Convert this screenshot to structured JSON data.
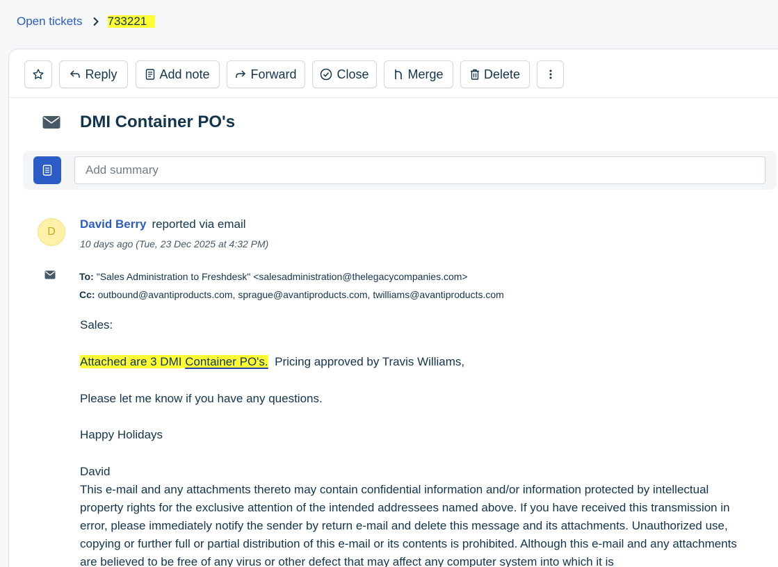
{
  "breadcrumb": {
    "parent": "Open tickets",
    "current": "733221"
  },
  "toolbar": {
    "reply": "Reply",
    "add_note": "Add note",
    "forward": "Forward",
    "close": "Close",
    "merge": "Merge",
    "delete": "Delete"
  },
  "ticket": {
    "subject": "DMI Container PO's",
    "summary_placeholder": "Add summary"
  },
  "message": {
    "avatar_letter": "D",
    "sender": "David Berry",
    "via": "reported via email",
    "timestamp": "10 days ago (Tue, 23 Dec 2025 at 4:32 PM)",
    "to_label": "To:",
    "to": "\"Sales Administration to Freshdesk\" <salesadministration@thelegacycompanies.com>",
    "cc_label": "Cc:",
    "cc": "outbound@avantiproducts.com, sprague@avantiproducts.com, twilliams@avantiproducts.com",
    "greeting": "Sales:",
    "line1_a": "Attached are 3 DMI ",
    "line1_b": "Container PO's.",
    "line1_c": "  Pricing approved by Travis Williams,",
    "line2": "Please let me know if you have any questions.",
    "line3": "Happy Holidays",
    "signature": "David",
    "disclaimer": "This e-mail and any attachments thereto may contain confidential information and/or information protected by intellectual property rights for the exclusive attention of the intended addressees named above. If you have received this transmission in error, please immediately notify the sender by return e-mail and delete this message and its attachments. Unauthorized use, copying or further full or partial distribution of this e-mail or its contents is prohibited. Although this e-mail and any attachments are believed to be free of any virus or other defect that may affect any computer system into which it is"
  },
  "icons": {
    "chevron": "chevron-right-icon",
    "star": "star-icon",
    "reply": "reply-icon",
    "note": "note-icon",
    "forward": "forward-icon",
    "close": "check-circle-icon",
    "merge": "merge-icon",
    "delete": "trash-icon",
    "more": "more-vertical-icon",
    "mail": "envelope-icon",
    "summary": "document-icon"
  },
  "colors": {
    "link": "#2c5cc5",
    "text": "#12344d",
    "highlight": "#ffff33",
    "accent_button": "#2c5cc5"
  }
}
